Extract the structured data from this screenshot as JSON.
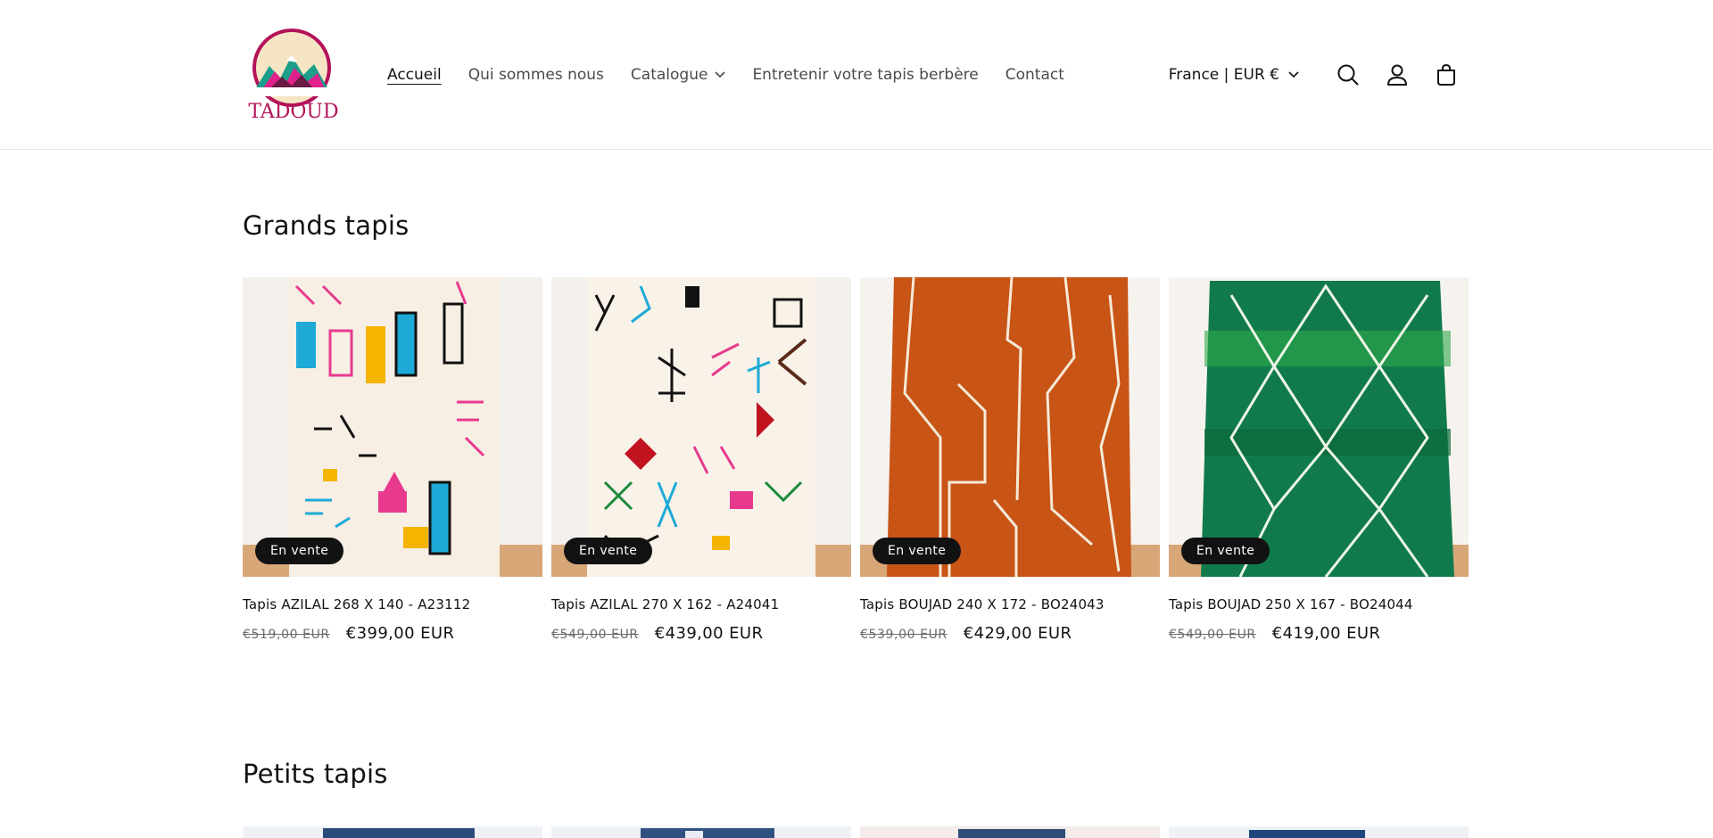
{
  "brand": {
    "logo_text": "TADOUD",
    "logo_color": "#b3135a"
  },
  "nav": {
    "items": [
      {
        "label": "Accueil"
      },
      {
        "label": "Qui sommes nous"
      },
      {
        "label": "Catalogue"
      },
      {
        "label": "Entretenir votre tapis berbère"
      },
      {
        "label": "Contact"
      }
    ]
  },
  "header": {
    "locale": "France | EUR €",
    "icons": [
      "search-icon",
      "account-icon",
      "cart-icon"
    ]
  },
  "sections": [
    {
      "title": "Grands tapis",
      "products": [
        {
          "badge": "En vente",
          "title": "Tapis AZILAL 268 X 140 - A23112",
          "price_old": "€519,00 EUR",
          "price_new": "€399,00 EUR"
        },
        {
          "badge": "En vente",
          "title": "Tapis AZILAL 270 X 162 - A24041",
          "price_old": "€549,00 EUR",
          "price_new": "€439,00 EUR"
        },
        {
          "badge": "En vente",
          "title": "Tapis BOUJAD 240 X 172 - BO24043",
          "price_old": "€539,00 EUR",
          "price_new": "€429,00 EUR"
        },
        {
          "badge": "En vente",
          "title": "Tapis BOUJAD 250 X 167 - BO24044",
          "price_old": "€549,00 EUR",
          "price_new": "€419,00 EUR"
        }
      ]
    },
    {
      "title": "Petits tapis"
    }
  ],
  "colors": {
    "text": "#121212",
    "badge_bg": "#121212",
    "rug_orange": "#c85416",
    "rug_green": "#117a4c"
  }
}
